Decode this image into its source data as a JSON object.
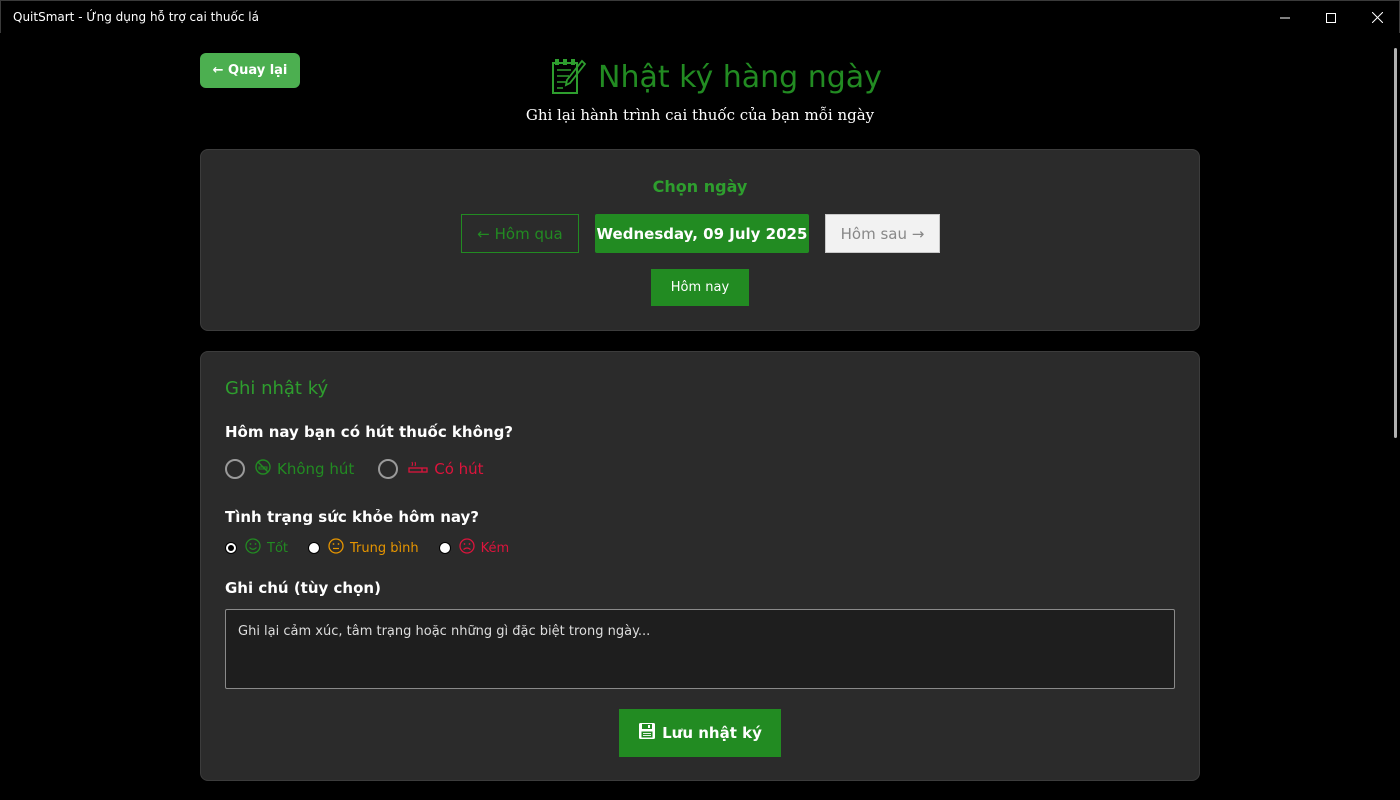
{
  "window": {
    "title": "QuitSmart - Ứng dụng hỗ trợ cai thuốc lá",
    "controls": [
      "minimize-icon",
      "maximize-icon",
      "close-icon"
    ]
  },
  "header": {
    "back_label": "← Quay lại",
    "title": "Nhật ký hàng ngày",
    "title_icon": "memo-icon",
    "subtitle": "Ghi lại hành trình cai thuốc của bạn mỗi ngày"
  },
  "date_picker": {
    "heading": "Chọn ngày",
    "prev_label": "← Hôm qua",
    "current_date": "Wednesday, 09 July 2025",
    "next_label": "Hôm sau →",
    "today_label": "Hôm nay"
  },
  "journal": {
    "heading": "Ghi nhật ký",
    "smoke_question": "Hôm nay bạn có hút thuốc không?",
    "smoke_options": [
      {
        "label": "Không hút",
        "icon": "no-smoking-icon",
        "selected": false
      },
      {
        "label": "Có hút",
        "icon": "cigarette-icon",
        "selected": false
      }
    ],
    "health_question": "Tình trạng sức khỏe hôm nay?",
    "health_options": [
      {
        "label": "Tốt",
        "icon": "smile-icon",
        "selected": true
      },
      {
        "label": "Trung bình",
        "icon": "neutral-face-icon",
        "selected": false
      },
      {
        "label": "Kém",
        "icon": "sad-face-icon",
        "selected": false
      }
    ],
    "note_label": "Ghi chú (tùy chọn)",
    "note_placeholder": "Ghi lại cảm xúc, tâm trạng hoặc những gì đặc biệt trong ngày...",
    "note_value": "",
    "save_label": "Lưu nhật ký",
    "save_icon": "floppy-disk-icon"
  },
  "colors": {
    "accent_green": "#228b22",
    "back_button_green": "#4caf50",
    "red": "#dc143c",
    "orange": "#e69500",
    "card_bg": "#2b2b2b",
    "background": "#000000"
  }
}
